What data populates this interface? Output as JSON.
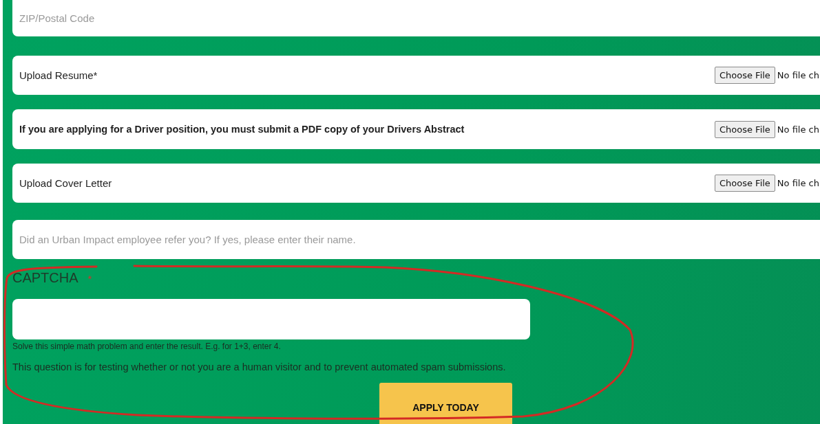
{
  "fields": [
    {
      "kind": "text",
      "placeholder": "ZIP/Postal Code"
    },
    {
      "kind": "file",
      "label": "Upload Resume*",
      "bold": false,
      "button": "Choose File",
      "status": "No file ch"
    },
    {
      "kind": "file",
      "label": "If you are applying for a Driver position, you must submit a PDF copy of your Drivers Abstract",
      "bold": true,
      "button": "Choose File",
      "status": "No file ch"
    },
    {
      "kind": "file",
      "label": "Upload Cover Letter",
      "bold": false,
      "button": "Choose File",
      "status": "No file ch"
    },
    {
      "kind": "text",
      "placeholder": "Did an Urban Impact employee refer you? If yes, please enter their name."
    }
  ],
  "captcha": {
    "label": "CAPTCHA",
    "required_mark": "*",
    "help": "Solve this simple math problem and enter the result. E.g. for 1+3, enter 4.",
    "note": "This question is for testing whether or not you are a human visitor and to prevent automated spam submissions."
  },
  "submit": "APPLY TODAY"
}
